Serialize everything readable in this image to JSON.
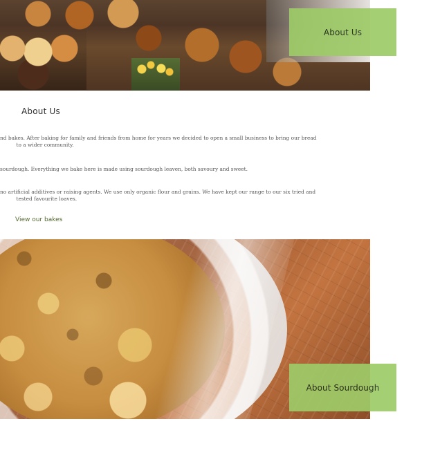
{
  "cards": {
    "top_title": "About Us",
    "bottom_title": "About Sourdough"
  },
  "section": {
    "heading": "About Us",
    "paragraphs": [
      "nd bakes. After baking for family and friends from home for years we decided to open a small business to bring our bread\n          to a wider community.",
      "sourdough. Everything we bake here is made using sourdough leaven, both savoury and sweet.",
      "no artificial additives or raising agents. We use only organic flour and grains. We have kept our range to our six tried and\n          tested favourite loaves."
    ],
    "cta": "View our bakes"
  },
  "icons": {
    "hero": "bakery-photo-icon",
    "sourdough": "sourdough-photo-icon"
  },
  "colors": {
    "accent": "#9ecb68",
    "heading": "#2f2f2f",
    "body": "#555555",
    "link": "#556a31"
  }
}
